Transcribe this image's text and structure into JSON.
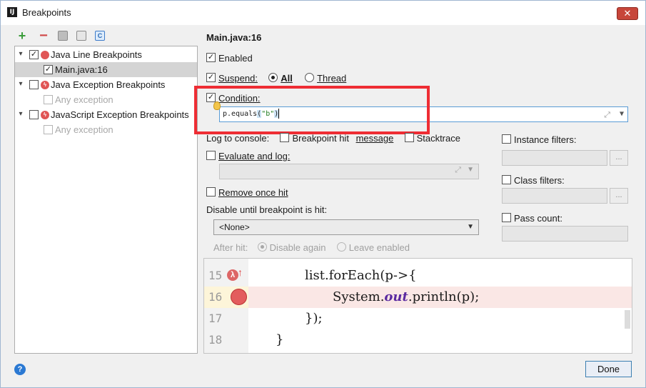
{
  "window": {
    "title": "Breakpoints",
    "app_icon": "IJ",
    "close_glyph": "✕"
  },
  "toolbar": {
    "add_glyph": "+",
    "remove_glyph": "−",
    "class_glyph": "C"
  },
  "tree": {
    "groups": [
      {
        "label": "Java Line Breakpoints",
        "checked": true,
        "icon": "red-dot-icon",
        "children": [
          {
            "label": "Main.java:16",
            "checked": true,
            "selected": true,
            "disabled": false
          }
        ]
      },
      {
        "label": "Java Exception Breakpoints",
        "checked": false,
        "icon": "exception-icon",
        "children": [
          {
            "label": "Any exception",
            "checked": false,
            "selected": false,
            "disabled": true
          }
        ]
      },
      {
        "label": "JavaScript Exception Breakpoints",
        "checked": false,
        "icon": "exception-icon",
        "children": [
          {
            "label": "Any exception",
            "checked": false,
            "selected": false,
            "disabled": true
          }
        ]
      }
    ]
  },
  "details": {
    "title": "Main.java:16",
    "enabled_label": "Enabled",
    "suspend_label": "Suspend:",
    "suspend_all": "All",
    "suspend_thread": "Thread",
    "condition_label": "Condition:",
    "condition_value": {
      "pre": "p.equals",
      "open": "(",
      "str": "\"b\"",
      "close": ")"
    },
    "log_to_console": "Log to console:",
    "breakpoint_hit": "Breakpoint hit",
    "message_label": "message",
    "stacktrace_label": "Stacktrace",
    "evaluate_and_log": "Evaluate and log:",
    "remove_once_hit": "Remove once hit",
    "disable_until": "Disable until breakpoint is hit:",
    "disable_until_value": "<None>",
    "after_hit": "After hit:",
    "disable_again": "Disable again",
    "leave_enabled": "Leave enabled",
    "instance_filters": "Instance filters:",
    "class_filters": "Class filters:",
    "pass_count": "Pass count:",
    "more_glyph": "..."
  },
  "editor": {
    "lines": [
      {
        "number": "15",
        "code": "list.forEach(p->{"
      },
      {
        "number": "16",
        "code_pre": "System.",
        "code_kw": "out",
        "code_post": ".println(p);"
      },
      {
        "number": "17",
        "code": "});"
      },
      {
        "number": "18",
        "code": "}"
      }
    ]
  },
  "footer": {
    "help_glyph": "?",
    "done_label": "Done"
  },
  "colors": {
    "accent": "#3c7fb1",
    "highlight_box": "#ee2d34",
    "breakpoint": "#e35d5d"
  }
}
